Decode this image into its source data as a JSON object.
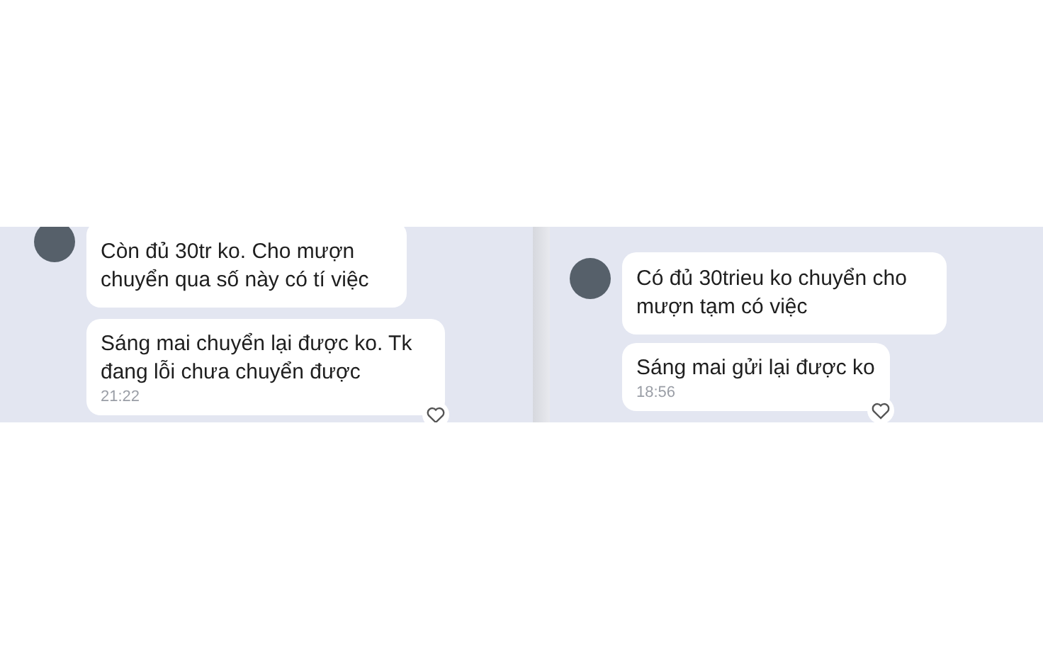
{
  "conversations": [
    {
      "messages": [
        {
          "text": "Còn đủ 30tr ko. Cho mượn chuyển qua số này có tí việc"
        },
        {
          "text": "Sáng mai chuyển lại được ko. Tk đang lỗi chưa chuyển được",
          "time": "21:22"
        }
      ]
    },
    {
      "messages": [
        {
          "text": "Có đủ 30trieu ko chuyển cho mượn tạm có việc"
        },
        {
          "text": "Sáng mai gửi lại được ko",
          "time": "18:56"
        }
      ]
    }
  ]
}
